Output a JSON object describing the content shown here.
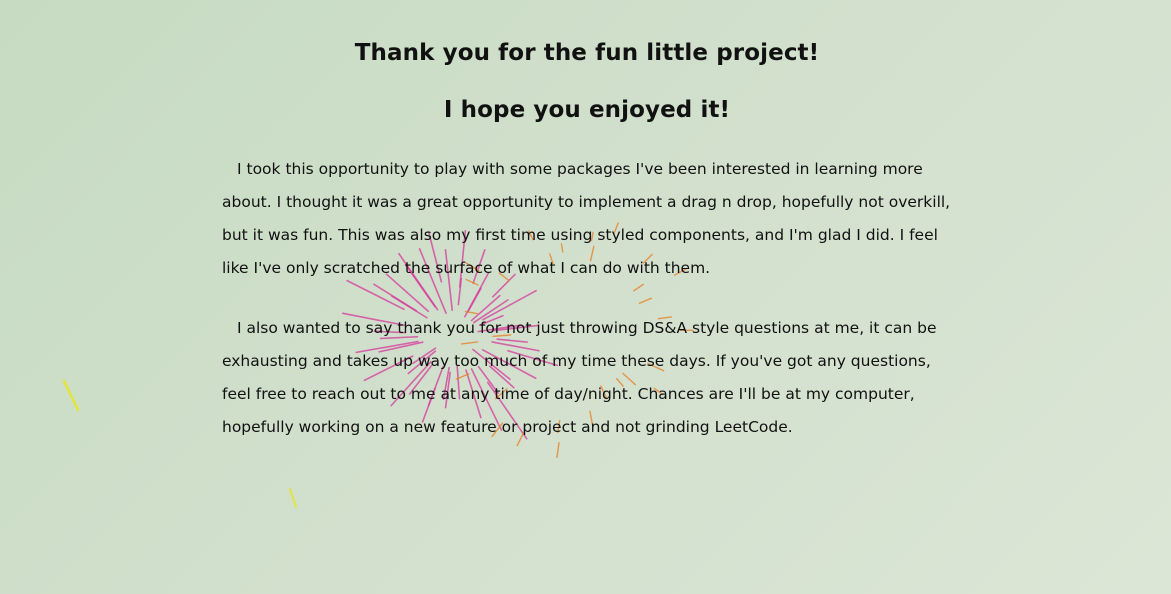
{
  "heading": "Thank you for the fun little project!",
  "subheading": "I hope you enjoyed it!",
  "paragraphs": [
    "I took this opportunity to play with some packages I've been interested in learning more about. I thought it was a great opportunity to implement a drag n drop, hopefully not overkill, but it was fun. This was also my first time using styled components, and I'm glad I did. I feel like I've only scratched the surface of what I can do with them.",
    "I also wanted to say thank you for not just throwing DS&A style questions at me, it can be exhausting and takes up way too much of my time these days. If you've got any questions, feel free to reach out to me at any time of day/night. Chances are I'll be at my computer, hopefully working on a new feature or project and not grinding LeetCode."
  ],
  "colors": {
    "firework_pink": "#d6399c",
    "firework_orange": "#e8832a",
    "firework_yellow": "#e6e629"
  }
}
